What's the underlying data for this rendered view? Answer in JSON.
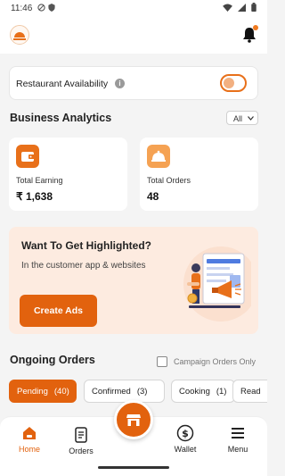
{
  "status_bar": {
    "time": "11:46",
    "left_icons": [
      "circle-slash-icon",
      "shield-icon"
    ],
    "right_icons": [
      "wifi-icon",
      "signal-icon",
      "battery-icon"
    ]
  },
  "header": {
    "logo": "restaurant-logo",
    "notification_icon": "bell-icon",
    "accent_color": "#e8701a"
  },
  "availability": {
    "label": "Restaurant Availability",
    "info_icon": "info-icon",
    "toggle_on": false
  },
  "analytics": {
    "title": "Business Analytics",
    "filter_value": "All",
    "stats": [
      {
        "label": "Total Earning",
        "value": "₹ 1,638",
        "icon": "wallet-icon"
      },
      {
        "label": "Total Orders",
        "value": "48",
        "icon": "food-cloche-icon"
      }
    ]
  },
  "promo": {
    "title": "Want To Get Highlighted?",
    "subtitle": "In the customer app & websites",
    "button_label": "Create Ads",
    "illustration": "advertising-illustration"
  },
  "ongoing": {
    "title": "Ongoing Orders",
    "campaign_label": "Campaign Orders Only",
    "campaign_checked": false,
    "chips": [
      {
        "label": "Pending",
        "count": "(40)",
        "active": true
      },
      {
        "label": "Confirmed",
        "count": "(3)",
        "active": false
      },
      {
        "label": "Cooking",
        "count": "(1)",
        "active": false
      },
      {
        "label": "Read",
        "count": "",
        "active": false
      }
    ]
  },
  "bottom_nav": {
    "items": [
      {
        "label": "Home",
        "icon": "home-icon",
        "active": true
      },
      {
        "label": "Orders",
        "icon": "orders-icon",
        "active": false
      },
      {
        "label": "Wallet",
        "icon": "wallet-dollar-icon",
        "active": false
      },
      {
        "label": "Menu",
        "icon": "menu-icon",
        "active": false
      }
    ],
    "center_button_icon": "store-icon"
  }
}
